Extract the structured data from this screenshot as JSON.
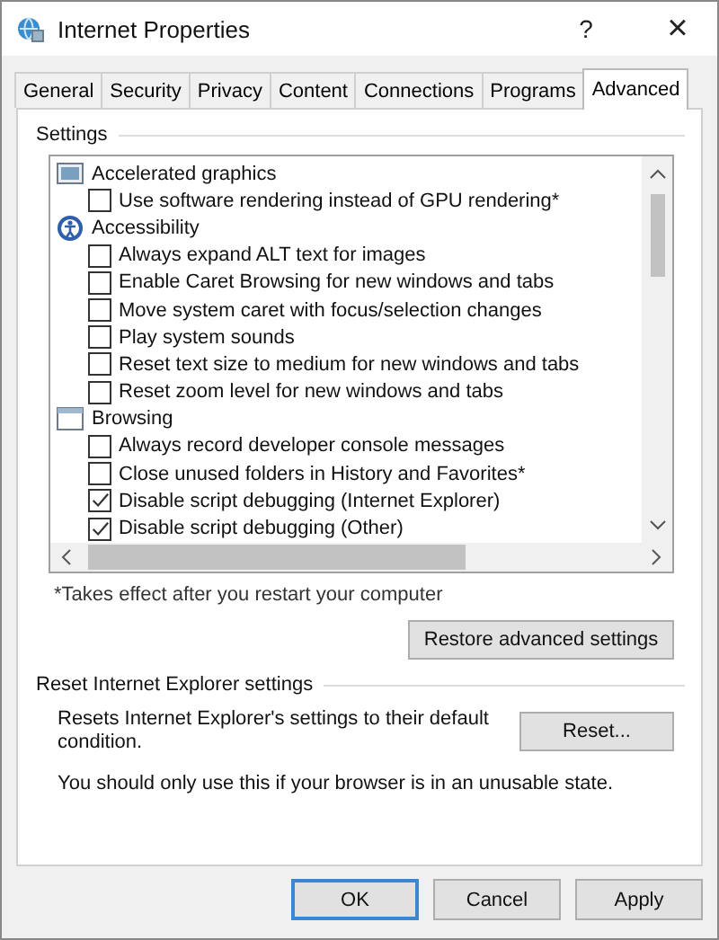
{
  "window": {
    "title": "Internet Properties",
    "help": "?",
    "close": "×"
  },
  "tabs": [
    {
      "label": "General",
      "selected": false
    },
    {
      "label": "Security",
      "selected": false
    },
    {
      "label": "Privacy",
      "selected": false
    },
    {
      "label": "Content",
      "selected": false
    },
    {
      "label": "Connections",
      "selected": false
    },
    {
      "label": "Programs",
      "selected": false
    },
    {
      "label": "Advanced",
      "selected": true
    }
  ],
  "settings": {
    "label": "Settings",
    "items": [
      {
        "kind": "category",
        "label": "Accelerated graphics",
        "children": [
          {
            "kind": "checkbox",
            "label": "Use software rendering instead of GPU rendering*",
            "checked": false
          }
        ]
      },
      {
        "kind": "category",
        "label": "Accessibility",
        "children": [
          {
            "kind": "checkbox",
            "label": "Always expand ALT text for images",
            "checked": false
          },
          {
            "kind": "checkbox",
            "label": "Enable Caret Browsing for new windows and tabs",
            "checked": false
          },
          {
            "kind": "checkbox",
            "label": "Move system caret with focus/selection changes",
            "checked": false
          },
          {
            "kind": "checkbox",
            "label": "Play system sounds",
            "checked": false
          },
          {
            "kind": "checkbox",
            "label": "Reset text size to medium for new windows and tabs",
            "checked": false
          },
          {
            "kind": "checkbox",
            "label": "Reset zoom level for new windows and tabs",
            "checked": false
          }
        ]
      },
      {
        "kind": "category",
        "label": "Browsing",
        "children": [
          {
            "kind": "checkbox",
            "label": "Always record developer console messages",
            "checked": false
          },
          {
            "kind": "checkbox",
            "label": "Close unused folders in History and Favorites*",
            "checked": false
          },
          {
            "kind": "checkbox",
            "label": "Disable script debugging (Internet Explorer)",
            "checked": true
          },
          {
            "kind": "checkbox",
            "label": "Disable script debugging (Other)",
            "checked": true
          }
        ]
      }
    ],
    "footnote": "*Takes effect after you restart your computer",
    "restore_button": "Restore advanced settings"
  },
  "reset": {
    "label": "Reset Internet Explorer settings",
    "description": "Resets Internet Explorer's settings to their default condition.",
    "button": "Reset...",
    "note": "You should only use this if your browser is in an unusable state."
  },
  "buttons": [
    {
      "label": "OK",
      "default": true
    },
    {
      "label": "Cancel",
      "default": false
    },
    {
      "label": "Apply",
      "default": false
    }
  ]
}
